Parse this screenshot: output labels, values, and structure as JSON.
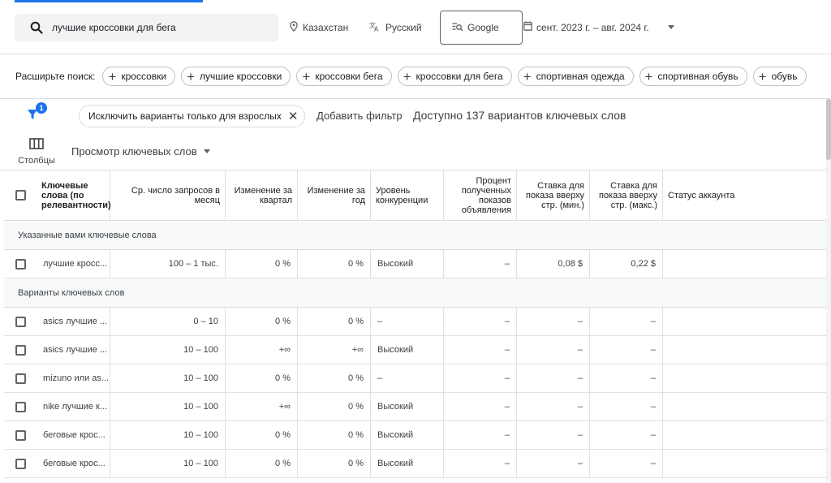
{
  "search": {
    "query": "лучшие кроссовки для бега",
    "location": "Казахстан",
    "language": "Русский",
    "engine": "Google",
    "date_range": "сент. 2023 г. – авг. 2024 г."
  },
  "expand": {
    "label": "Расширьте поиск:",
    "chips": [
      "кроссовки",
      "лучшие кроссовки",
      "кроссовки бега",
      "кроссовки для бега",
      "спортивная одежда",
      "спортивная обувь",
      "обувь"
    ]
  },
  "filters": {
    "count_badge": "1",
    "active_filter": "Исключить варианты только для взрослых",
    "add_filter": "Добавить фильтр",
    "available": "Доступно 137 вариантов ключевых слов"
  },
  "toolbar": {
    "columns_label": "Столбцы",
    "view_label": "Просмотр ключевых слов"
  },
  "table": {
    "headers": [
      "Ключевые слова (по релевантности)",
      "Ср. число запросов в месяц",
      "Изменение за квартал",
      "Изменение за год",
      "Уровень конкуренции",
      "Процент полученных показов объявления",
      "Ставка для показа вверху стр. (мин.)",
      "Ставка для показа вверху стр. (макс.)",
      "Статус аккаунта"
    ],
    "group_provided": "Указанные вами ключевые слова",
    "provided_rows": [
      [
        "лучшие кросс...",
        "100 – 1 тыс.",
        "0 %",
        "0 %",
        "Высокий",
        "–",
        "0,08 $",
        "0,22 $",
        ""
      ]
    ],
    "group_ideas": "Варианты ключевых слов",
    "idea_rows": [
      [
        "asics лучшие ...",
        "0 – 10",
        "0 %",
        "0 %",
        "–",
        "–",
        "–",
        "–",
        ""
      ],
      [
        "asics лучшие ...",
        "10 – 100",
        "+∞",
        "+∞",
        "Высокий",
        "–",
        "–",
        "–",
        ""
      ],
      [
        "mizuno или as...",
        "10 – 100",
        "0 %",
        "0 %",
        "–",
        "–",
        "–",
        "–",
        ""
      ],
      [
        "nike лучшие к...",
        "10 – 100",
        "+∞",
        "0 %",
        "Высокий",
        "–",
        "–",
        "–",
        ""
      ],
      [
        "беговые крос...",
        "10 – 100",
        "0 %",
        "0 %",
        "Высокий",
        "–",
        "–",
        "–",
        ""
      ],
      [
        "беговые крос...",
        "10 – 100",
        "0 %",
        "0 %",
        "Высокий",
        "–",
        "–",
        "–",
        ""
      ]
    ]
  }
}
